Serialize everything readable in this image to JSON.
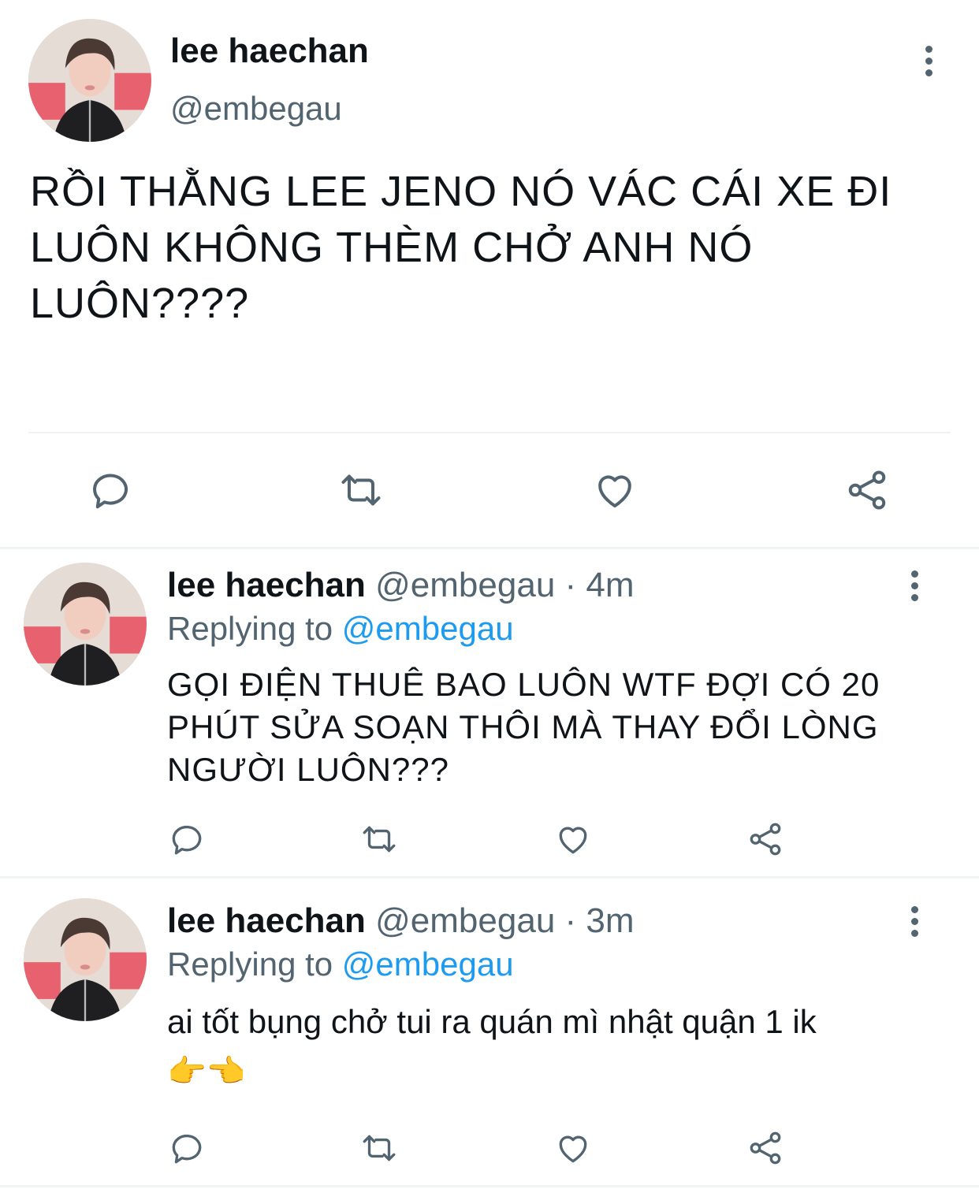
{
  "main_tweet": {
    "display_name": "lee haechan",
    "handle": "@embegau",
    "text_lines": [
      "RỒI THẰNG LEE JENO NÓ VÁC CÁI XE ĐI",
      "LUÔN KHÔNG THÈM CHỞ ANH NÓ",
      "LUÔN????"
    ],
    "more_icon": "more-vertical-icon"
  },
  "replies": [
    {
      "display_name": "lee haechan",
      "handle": "@embegau",
      "separator": "·",
      "time": "4m",
      "replying_prefix": "Replying to",
      "replying_handle": "@embegau",
      "text_lines": [
        "GỌI ĐIỆN THUÊ BAO LUÔN WTF ĐỢI CÓ 20",
        "PHÚT SỬA SOẠN THÔI MÀ THAY ĐỔI LÒNG",
        "NGƯỜI LUÔN???"
      ]
    },
    {
      "display_name": "lee haechan",
      "handle": "@embegau",
      "separator": "·",
      "time": "3m",
      "replying_prefix": "Replying to",
      "replying_handle": "@embegau",
      "text_lines": [
        "ai tốt bụng chở tui ra quán mì nhật quận 1 ik"
      ],
      "emoji": "👉👈"
    }
  ],
  "actions": [
    "reply-icon",
    "retweet-icon",
    "like-icon",
    "share-icon"
  ],
  "colors": {
    "accent": "#1d9bf0",
    "muted": "#536471",
    "text": "#0f1419",
    "divider": "#eff3f4"
  }
}
